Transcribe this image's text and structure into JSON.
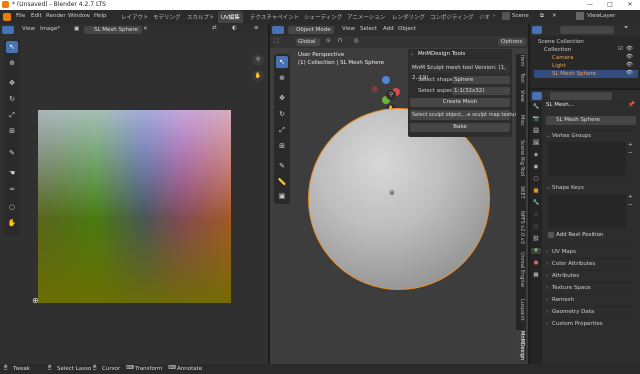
{
  "window": {
    "title": "* (Unsaved) - Blender 4.2.7 LTS",
    "min": "—",
    "max": "□",
    "close": "✕"
  },
  "menu": [
    "File",
    "Edit",
    "Render",
    "Window",
    "Help"
  ],
  "workspaces": [
    "レイアウト",
    "モデリング",
    "スカルプト",
    "UV編集",
    "テクスチャペイント",
    "シェーディング",
    "アニメーション",
    "レンダリング",
    "コンポジティング",
    "ジオ"
  ],
  "active_workspace": "UV編集",
  "scene": {
    "label": "Scene",
    "view_layer": "ViewLayer"
  },
  "uv_editor": {
    "menus": [
      "View",
      "Image*"
    ],
    "image_name": "SL Mesh Sphere"
  },
  "viewport": {
    "mode": "Object Mode",
    "menus": [
      "View",
      "Select",
      "Add",
      "Object"
    ],
    "transform": "Global",
    "options": "Options",
    "overlay_title": "User Perspective",
    "overlay_sub": "(1) Collection | SL Mesh Sphere"
  },
  "npanel": {
    "title": "MnMDesign Tools",
    "version_line": "MnM Sculpt mesh tool Version: (1, 2, 19)",
    "shape_label": "Select shape",
    "shape_value": "Sphere",
    "aspect_label": "Select aspect",
    "aspect_value": "1:1(32x32)",
    "create_btn": "Create Mesh",
    "sculpt_btn": "Select sculpt object,...e sculpt map texture",
    "bake_btn": "Bake",
    "vtabs": [
      "Item",
      "Tool",
      "View",
      "Misc",
      "Scene Rig Tool",
      "SKET",
      "NPFS v2.0 v3",
      "Unreal Engine",
      "Luxpaint",
      "MnMDesign"
    ],
    "active_vtab": "MnMDesign"
  },
  "outliner": {
    "root": "Scene Collection",
    "items": [
      {
        "label": "Collection",
        "indent": 1
      },
      {
        "label": "Camera",
        "indent": 2
      },
      {
        "label": "Light",
        "indent": 2
      },
      {
        "label": "SL Mesh Sphere",
        "indent": 2
      }
    ]
  },
  "properties": {
    "object_name": "SL Mesh...",
    "mesh_name": "SL Mesh Sphere",
    "vertex_groups": "Vertex Groups",
    "shape_keys": "Shape Keys",
    "add_rest": "Add Rest Position",
    "sections": [
      "UV Maps",
      "Color Attributes",
      "Attributes",
      "Texture Space",
      "Remesh",
      "Geometry Data",
      "Custom Properties"
    ]
  },
  "statusbar": {
    "items": [
      "Tweak",
      "Select Lasso",
      "Cursor",
      "Transform",
      "Annotate"
    ]
  }
}
